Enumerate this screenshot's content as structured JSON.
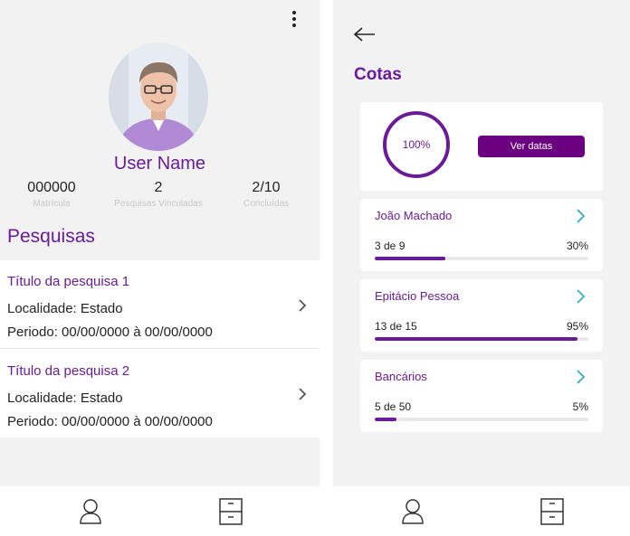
{
  "profile": {
    "user_name": "User Name",
    "stats": [
      {
        "value": "000000",
        "label": "Matrícula"
      },
      {
        "value": "2",
        "label": "Pesquisas Vinculadas"
      },
      {
        "value": "2/10",
        "label": "Concluídas"
      }
    ],
    "section_title": "Pesquisas",
    "surveys": [
      {
        "title": "Título da pesquisa 1",
        "locality": "Localidade: Estado",
        "period": "Periodo: 00/00/0000 à 00/00/0000"
      },
      {
        "title": "Título da pesquisa 2",
        "locality": "Localidade: Estado",
        "period": "Periodo: 00/00/0000 à 00/00/0000"
      }
    ]
  },
  "quotas": {
    "title": "Cotas",
    "summary": {
      "percent_text": "100%",
      "button_label": "Ver datas"
    },
    "items": [
      {
        "name": "João Machado",
        "count": "3 de 9",
        "percent_text": "30%",
        "progress": 0.33
      },
      {
        "name": "Epitácio Pessoa",
        "count": "13 de 15",
        "percent_text": "95%",
        "progress": 0.95
      },
      {
        "name": "Bancários",
        "count": "5 de 50",
        "percent_text": "5%",
        "progress": 0.1
      }
    ]
  },
  "nav": {
    "items": [
      {
        "icon": "user-icon"
      },
      {
        "icon": "cabinet-icon"
      }
    ]
  },
  "colors": {
    "accent": "#6a1b9a",
    "button": "#6a0080",
    "chevron": "#26a9c4"
  }
}
